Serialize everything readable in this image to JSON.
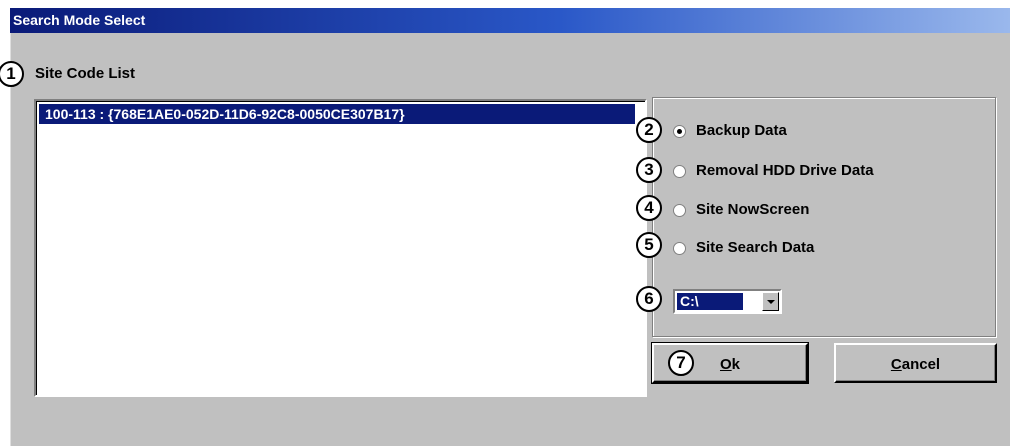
{
  "window": {
    "title": "Search Mode Select"
  },
  "site_list": {
    "label": "Site Code List",
    "items": [
      "100-113 : {768E1AE0-052D-11D6-92C8-0050CE307B17}"
    ]
  },
  "options": [
    {
      "label": "Backup Data",
      "selected": true
    },
    {
      "label": "Removal HDD Drive Data",
      "selected": false
    },
    {
      "label": "Site NowScreen",
      "selected": false
    },
    {
      "label": "Site Search Data",
      "selected": false
    }
  ],
  "drive_select": {
    "value": "C:\\"
  },
  "buttons": {
    "ok_prefix": "O",
    "ok_rest": "k",
    "cancel_prefix": "C",
    "cancel_rest": "ancel"
  },
  "callouts": [
    "1",
    "2",
    "3",
    "4",
    "5",
    "6",
    "7"
  ]
}
